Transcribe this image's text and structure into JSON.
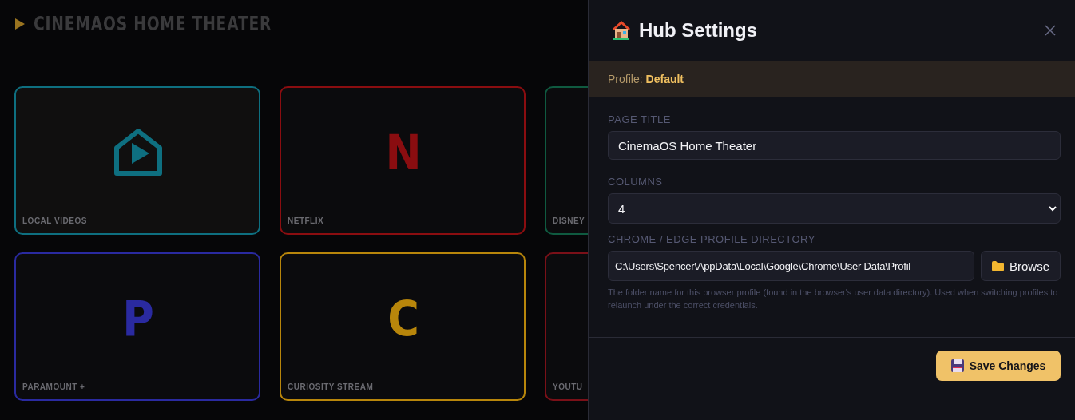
{
  "backdrop": {
    "title": "CINEMAOS HOME THEATER",
    "cards": [
      {
        "label": "LOCAL VIDEOS",
        "kind": "house",
        "color": "#0e6f80"
      },
      {
        "label": "NETFLIX",
        "kind": "letter",
        "logo": "N",
        "color": "#8a0d10"
      },
      {
        "label": "DISNEY",
        "kind": "none",
        "color": "#0f5a40"
      },
      {
        "label": "PARAMOUNT +",
        "kind": "letter",
        "logo": "P",
        "color": "#2a2aa0"
      },
      {
        "label": "CURIOSITY STREAM",
        "kind": "letter",
        "logo": "C",
        "color": "#b8860b"
      },
      {
        "label": "YOUTU",
        "kind": "none",
        "color": "#7a1018"
      }
    ]
  },
  "panel": {
    "title": "Hub Settings",
    "profile_label": "Profile:",
    "profile_name": "Default",
    "fields": [
      {
        "label": "PAGE TITLE",
        "kind": "text",
        "value": "CinemaOS Home Theater"
      },
      {
        "label": "COLUMNS",
        "kind": "select",
        "value": "4"
      },
      {
        "label": "CHROME / EDGE PROFILE DIRECTORY",
        "kind": "path",
        "value": "C:\\Users\\Spencer\\AppData\\Local\\Google\\Chrome\\User Data\\Profil",
        "button": "Browse",
        "hint": "The folder name for this browser profile (found in the browser's user data directory). Used when switching profiles to relaunch under the correct credentials."
      }
    ],
    "save_button": "Save Changes"
  }
}
